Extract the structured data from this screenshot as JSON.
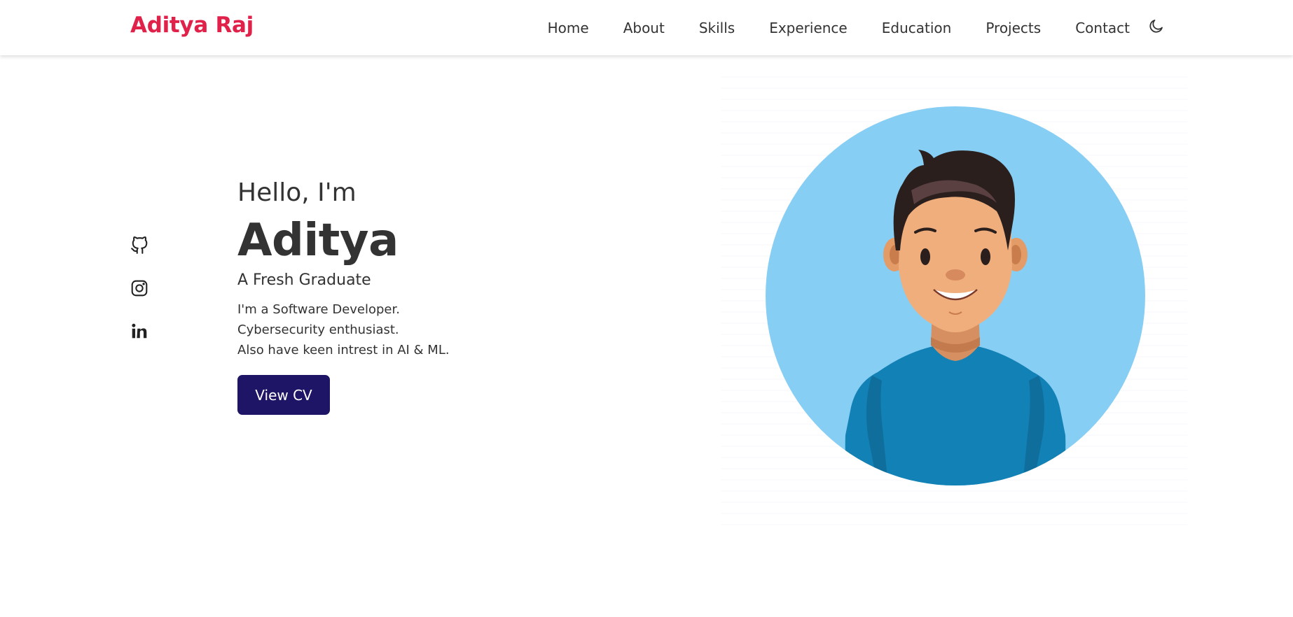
{
  "header": {
    "logo": "Aditya Raj",
    "nav": [
      "Home",
      "About",
      "Skills",
      "Experience",
      "Education",
      "Projects",
      "Contact"
    ],
    "theme_toggle_icon": "moon-icon"
  },
  "socials": [
    {
      "name": "github",
      "icon": "github-icon"
    },
    {
      "name": "instagram",
      "icon": "instagram-icon"
    },
    {
      "name": "linkedin",
      "icon": "linkedin-icon"
    }
  ],
  "hero": {
    "greeting": "Hello, I'm",
    "name": "Aditya",
    "tagline": "A Fresh Graduate",
    "about": [
      "I'm a Software Developer.",
      "Cybersecurity enthusiast.",
      "Also have keen intrest in AI & ML."
    ],
    "cv_button": "View CV"
  },
  "colors": {
    "logo": "#e0224b",
    "button": "#1f1566",
    "text": "#333333",
    "avatar_bg": "#87cef5"
  }
}
